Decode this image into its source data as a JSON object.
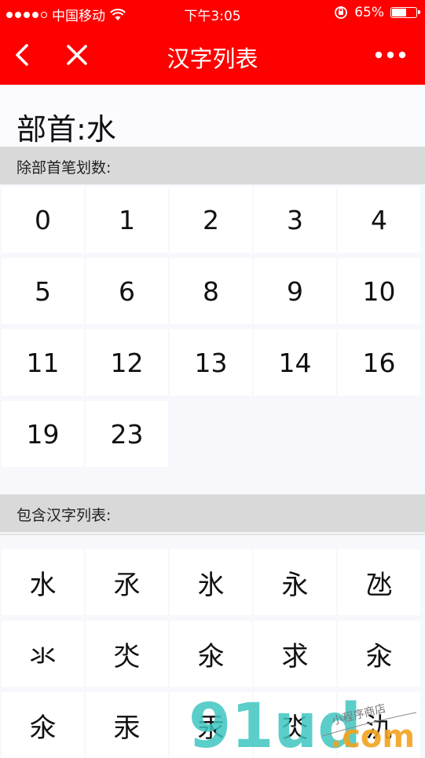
{
  "status_bar": {
    "carrier": "中国移动",
    "time": "下午3:05",
    "battery": "65%",
    "battery_level": 0.65
  },
  "nav": {
    "title": "汉字列表"
  },
  "radical": {
    "label": "部首:水"
  },
  "strokes_section": {
    "header": "除部首笔划数:",
    "items": [
      "0",
      "1",
      "2",
      "3",
      "4",
      "5",
      "6",
      "8",
      "9",
      "10",
      "11",
      "12",
      "13",
      "14",
      "16",
      "19",
      "23"
    ]
  },
  "chars_section": {
    "header": "包含汉字列表:",
    "items": [
      "水",
      "氶",
      "氷",
      "永",
      "氹",
      "氺",
      "氼",
      "氽",
      "求",
      "汆",
      "氽",
      "汞",
      "汞",
      "氼",
      "氿"
    ]
  },
  "watermark": {
    "brand": "91ud",
    "suffix": ".com",
    "tagline": "小程序商店"
  },
  "colors": {
    "accent": "#fe0000",
    "section_header": "#d9d9d9",
    "background": "#f8f7fc"
  }
}
